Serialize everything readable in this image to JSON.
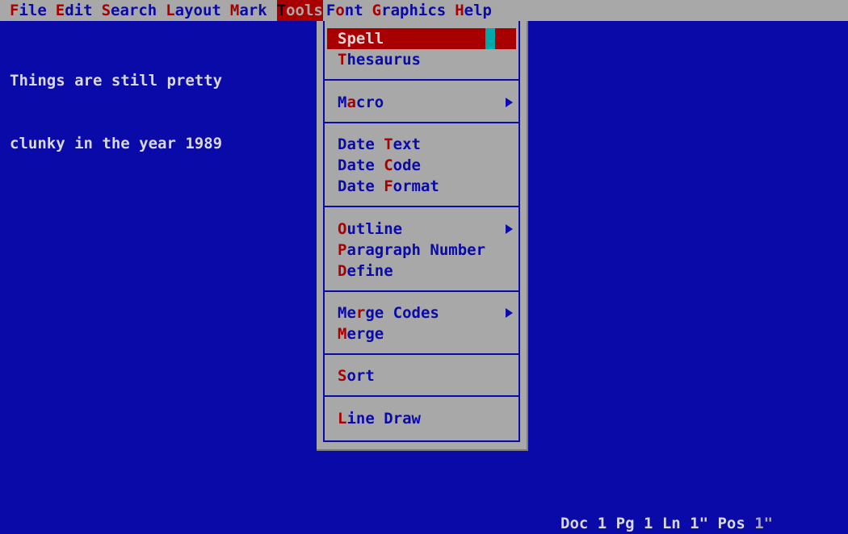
{
  "menubar": {
    "items": [
      {
        "hk": "F",
        "rest": "ile"
      },
      {
        "hk": "E",
        "rest": "dit"
      },
      {
        "hk": "S",
        "rest": "earch"
      },
      {
        "hk": "L",
        "rest": "ayout"
      },
      {
        "hk": "M",
        "rest": "ark"
      },
      {
        "hk": "T",
        "rest": "ools"
      },
      {
        "pre": "F",
        "hk": "o",
        "rest": "nt"
      },
      {
        "hk": "G",
        "rest": "raphics"
      },
      {
        "hk": "H",
        "rest": "elp"
      }
    ],
    "active": "Tools"
  },
  "document": {
    "line1": "Things are still pretty",
    "line2": "clunky in the year 1989"
  },
  "tools_menu": {
    "spell": {
      "hk": "S",
      "rest": "pell"
    },
    "thesaurus": {
      "hk": "T",
      "rest": "hesaurus"
    },
    "macro": {
      "pre": "M",
      "hk": "a",
      "rest": "cro"
    },
    "date_text": {
      "pre": "Date ",
      "hk": "T",
      "rest": "ext"
    },
    "date_code": {
      "pre": "Date ",
      "hk": "C",
      "rest": "ode"
    },
    "date_format": {
      "pre": "Date ",
      "hk": "F",
      "rest": "ormat"
    },
    "outline": {
      "hk": "O",
      "rest": "utline"
    },
    "paragraph_number": {
      "hk": "P",
      "rest": "aragraph Number"
    },
    "define": {
      "hk": "D",
      "rest": "efine"
    },
    "merge_codes": {
      "pre": "Me",
      "hk": "r",
      "rest": "ge Codes"
    },
    "merge": {
      "hk": "M",
      "rest": "erge"
    },
    "sort": {
      "hk": "S",
      "rest": "ort"
    },
    "line_draw": {
      "hk": "L",
      "rest": "ine Draw"
    }
  },
  "status": {
    "text": "Doc 1 Pg 1 Ln 1\" Pos ",
    "pos_value": "1\""
  },
  "colors": {
    "background": "#0a0aa8",
    "menu_gray": "#a8a8a8",
    "hotkey_red": "#a80000",
    "cursor_cyan": "#00a8a8"
  }
}
